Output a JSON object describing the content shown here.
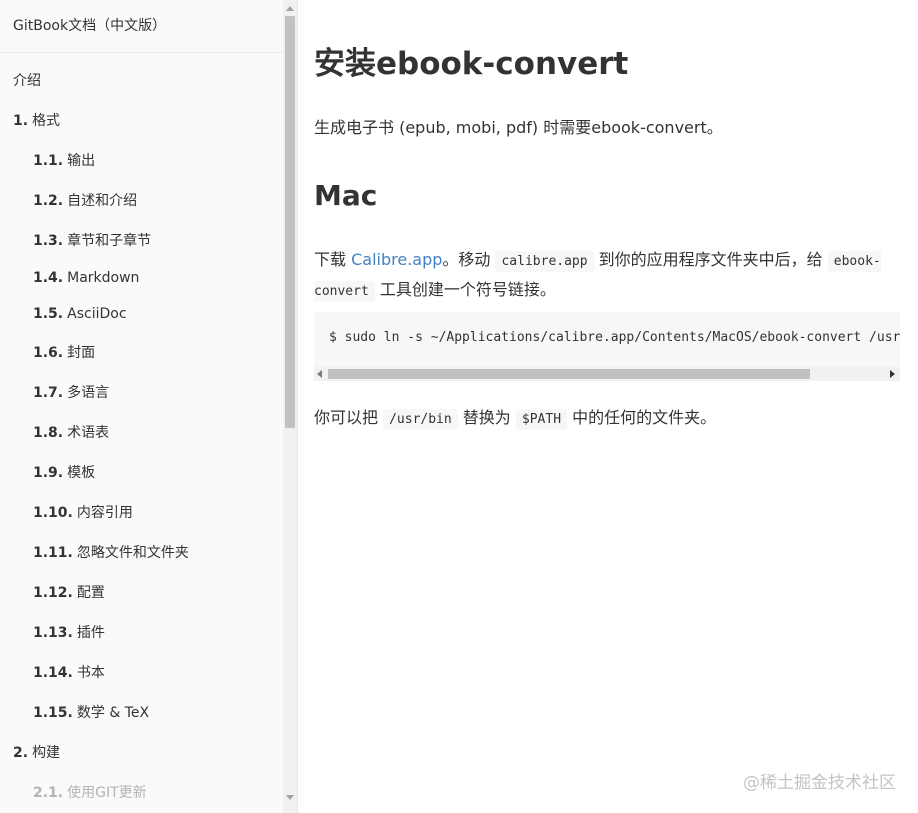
{
  "sidebar": {
    "book_title": "GitBook文档（中文版）",
    "items": [
      {
        "num": "",
        "label": "介绍"
      },
      {
        "num": "1.",
        "label": "格式"
      },
      {
        "num": "1.1.",
        "label": "输出"
      },
      {
        "num": "1.2.",
        "label": "自述和介绍"
      },
      {
        "num": "1.3.",
        "label": "章节和子章节"
      },
      {
        "num": "1.4.",
        "label": "Markdown"
      },
      {
        "num": "1.5.",
        "label": "AsciiDoc"
      },
      {
        "num": "1.6.",
        "label": "封面"
      },
      {
        "num": "1.7.",
        "label": "多语言"
      },
      {
        "num": "1.8.",
        "label": "术语表"
      },
      {
        "num": "1.9.",
        "label": "模板"
      },
      {
        "num": "1.10.",
        "label": "内容引用"
      },
      {
        "num": "1.11.",
        "label": "忽略文件和文件夹"
      },
      {
        "num": "1.12.",
        "label": "配置"
      },
      {
        "num": "1.13.",
        "label": "插件"
      },
      {
        "num": "1.14.",
        "label": "书本"
      },
      {
        "num": "1.15.",
        "label": "数学 & TeX"
      },
      {
        "num": "2.",
        "label": "构建"
      },
      {
        "num": "2.1.",
        "label": "使用GIT更新"
      }
    ]
  },
  "content": {
    "h1": "安装ebook-convert",
    "intro": "生成电子书 (epub, mobi, pdf) 时需要ebook-convert。",
    "h2": "Mac",
    "p2": {
      "t1": "下载 ",
      "link": "Calibre.app",
      "t2": "。移动 ",
      "code1": "calibre.app",
      "t3": " 到你的应用程序文件夹中后，给 ",
      "code2": "ebook-convert",
      "t4": " 工具创建一个符号链接。"
    },
    "code_block": "$ sudo ln -s ~/Applications/calibre.app/Contents/MacOS/ebook-convert /usr/bin",
    "p3": {
      "t1": "你可以把 ",
      "code1": "/usr/bin",
      "t2": " 替换为 ",
      "code2": "$PATH",
      "t3": " 中的任何的文件夹。"
    }
  },
  "watermark": "@稀土掘金技术社区"
}
